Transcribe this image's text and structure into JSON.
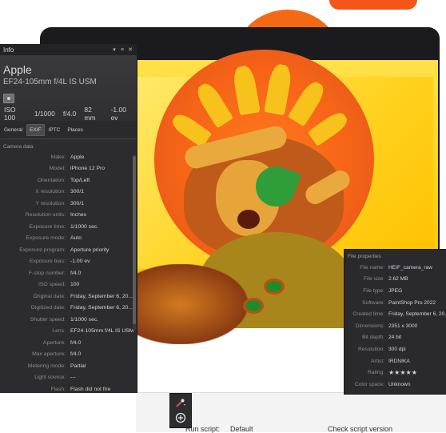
{
  "info_panel": {
    "title": "Info",
    "header": {
      "make": "Apple",
      "lens": "EF24-105mm f/4L IS USM",
      "exif_strip": [
        "ISO 100",
        "1/1000",
        "f/4.0",
        "82 mm",
        "-1.00 ev"
      ]
    },
    "tabs": [
      {
        "label": "General"
      },
      {
        "label": "EXIF"
      },
      {
        "label": "IPTC"
      },
      {
        "label": "Places"
      }
    ],
    "active_tab": "EXIF",
    "section_title": "Camera data",
    "rows": [
      {
        "label": "Make:",
        "value": "Apple"
      },
      {
        "label": "Model:",
        "value": "iPhone 12 Pro"
      },
      {
        "label": "Orientation:",
        "value": "Top/Left"
      },
      {
        "label": "X resolution:",
        "value": "300/1"
      },
      {
        "label": "Y resolution:",
        "value": "300/1"
      },
      {
        "label": "Resolution units:",
        "value": "Inches"
      },
      {
        "label": "Exposure time:",
        "value": "1/1000 sec."
      },
      {
        "label": "Exposure mode:",
        "value": "Auto"
      },
      {
        "label": "Exposure program:",
        "value": "Aperture priority"
      },
      {
        "label": "Exposure bias:",
        "value": "-1.00 ev"
      },
      {
        "label": "F-stop number:",
        "value": "f/4.0"
      },
      {
        "label": "ISO speed:",
        "value": "100"
      },
      {
        "label": "Original date:",
        "value": "Friday, September 6, 20..."
      },
      {
        "label": "Digitized date:",
        "value": "Friday, September 6, 20..."
      },
      {
        "label": "Shutter speed:",
        "value": "1/1000 sec."
      },
      {
        "label": "Lens:",
        "value": "EF24-105mm f/4L IS USM"
      },
      {
        "label": "Aperture:",
        "value": "f/4.0"
      },
      {
        "label": "Max aperture:",
        "value": "f/4.0"
      },
      {
        "label": "Metering mode:",
        "value": "Partial"
      },
      {
        "label": "Light source:",
        "value": "---"
      },
      {
        "label": "Flash:",
        "value": "Flash did not fire"
      }
    ]
  },
  "file_panel": {
    "title": "File properties",
    "rows": [
      {
        "label": "File name:",
        "value": "HEIF_camera_raw"
      },
      {
        "label": "File size:",
        "value": "2.62 MB"
      },
      {
        "label": "File type:",
        "value": "JPEG"
      },
      {
        "label": "Software:",
        "value": "PaintShop Pro 2022"
      },
      {
        "label": "Created time:",
        "value": "Friday, September 6, 20..."
      },
      {
        "label": "Dimensions:",
        "value": "2351 x 3000"
      },
      {
        "label": "Bit depth:",
        "value": "24 bit"
      },
      {
        "label": "Resolution:",
        "value": "300 dpi"
      },
      {
        "label": "Artist:",
        "value": "IRDNIKA"
      },
      {
        "label": "Rating:",
        "value": "★★★★★",
        "rating": 5
      },
      {
        "label": "Color space:",
        "value": "Unknown"
      }
    ]
  },
  "background_ui": {
    "run_script": "Run script:",
    "default": "Default",
    "check_script": "Check script version"
  },
  "colors": {
    "panel_bg": "#2c2c2e",
    "accent_orange": "#f66417",
    "accent_yellow": "#ffd315",
    "star": "#f2c300"
  },
  "icons": [
    "collapse-icon",
    "close-icon",
    "camera-icon",
    "eyedropper-icon",
    "plus-circle-icon"
  ]
}
